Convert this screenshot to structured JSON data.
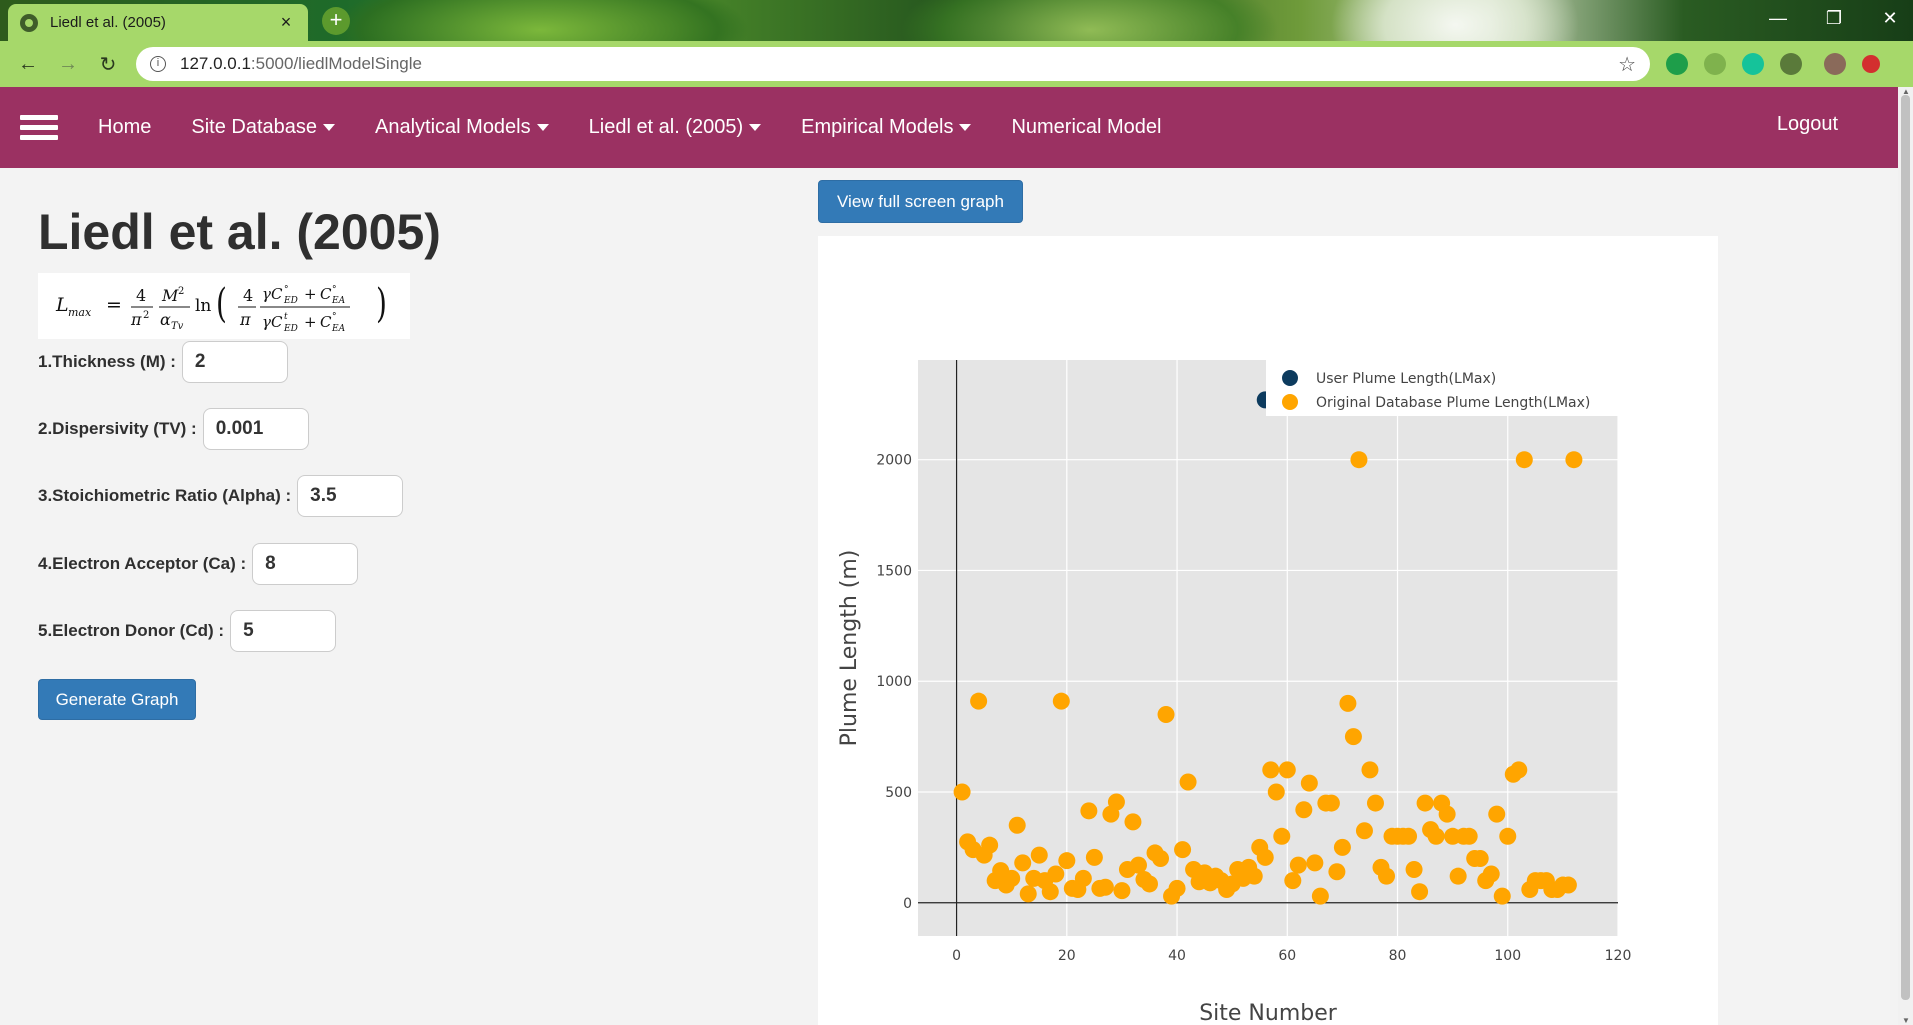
{
  "browser": {
    "tab_title": "Liedl et al. (2005)",
    "tab_close": "×",
    "new_tab": "+",
    "url_host": "127.0.0.1",
    "url_rest": ":5000/liedlModelSingle",
    "win_min": "—",
    "win_max": "❐",
    "win_close": "✕"
  },
  "nav": {
    "home": "Home",
    "site_database": "Site Database",
    "analytical_models": "Analytical Models",
    "liedl": "Liedl et al. (2005)",
    "empirical_models": "Empirical Models",
    "numerical_model": "Numerical Model",
    "logout": "Logout"
  },
  "page": {
    "title": "Liedl et al. (2005)"
  },
  "form": {
    "thickness_label": "1.Thickness (M) :",
    "thickness_value": "2",
    "dispersivity_label": "2.Dispersivity (TV) :",
    "dispersivity_value": "0.001",
    "stoich_label": "3.Stoichiometric Ratio (Alpha) :",
    "stoich_value": "3.5",
    "acceptor_label": "4.Electron Acceptor (Ca) :",
    "acceptor_value": "8",
    "donor_label": "5.Electron Donor (Cd) :",
    "donor_value": "5",
    "generate_label": "Generate Graph"
  },
  "graph_button": "View full screen graph",
  "colors": {
    "nav": "#9b3162",
    "user_series": "#0d3b5e",
    "db_series": "#ffa500",
    "button": "#337ab7"
  },
  "chart_data": {
    "type": "scatter",
    "xlabel": "Site Number",
    "ylabel": "Plume Length (m)",
    "xlim": [
      -7,
      120
    ],
    "ylim": [
      -150,
      2450
    ],
    "x_ticks": [
      0,
      20,
      40,
      60,
      80,
      100,
      120
    ],
    "y_ticks": [
      0,
      500,
      1000,
      1500,
      2000
    ],
    "grid": true,
    "legend_position": "top-right",
    "series": [
      {
        "name": "User Plume Length(LMax)",
        "color": "#0d3b5e",
        "points": [
          [
            56,
            2270
          ]
        ]
      },
      {
        "name": "Original Database Plume Length(LMax)",
        "color": "#ffa500",
        "points": [
          [
            1,
            500
          ],
          [
            2,
            275
          ],
          [
            3,
            240
          ],
          [
            4,
            910
          ],
          [
            5,
            215
          ],
          [
            6,
            260
          ],
          [
            7,
            100
          ],
          [
            8,
            145
          ],
          [
            9,
            80
          ],
          [
            10,
            110
          ],
          [
            11,
            350
          ],
          [
            12,
            180
          ],
          [
            13,
            40
          ],
          [
            14,
            110
          ],
          [
            15,
            215
          ],
          [
            16,
            100
          ],
          [
            17,
            50
          ],
          [
            18,
            130
          ],
          [
            19,
            910
          ],
          [
            20,
            190
          ],
          [
            21,
            65
          ],
          [
            22,
            60
          ],
          [
            23,
            110
          ],
          [
            24,
            415
          ],
          [
            25,
            205
          ],
          [
            26,
            65
          ],
          [
            27,
            70
          ],
          [
            28,
            400
          ],
          [
            29,
            455
          ],
          [
            30,
            55
          ],
          [
            31,
            150
          ],
          [
            32,
            365
          ],
          [
            33,
            170
          ],
          [
            34,
            105
          ],
          [
            35,
            85
          ],
          [
            36,
            225
          ],
          [
            37,
            200
          ],
          [
            38,
            850
          ],
          [
            39,
            30
          ],
          [
            40,
            65
          ],
          [
            41,
            240
          ],
          [
            42,
            545
          ],
          [
            43,
            150
          ],
          [
            44,
            95
          ],
          [
            45,
            135
          ],
          [
            46,
            90
          ],
          [
            47,
            120
          ],
          [
            48,
            100
          ],
          [
            49,
            60
          ],
          [
            50,
            85
          ],
          [
            51,
            150
          ],
          [
            52,
            110
          ],
          [
            53,
            160
          ],
          [
            54,
            120
          ],
          [
            55,
            250
          ],
          [
            56,
            205
          ],
          [
            57,
            600
          ],
          [
            58,
            500
          ],
          [
            59,
            300
          ],
          [
            60,
            600
          ],
          [
            61,
            100
          ],
          [
            62,
            170
          ],
          [
            63,
            420
          ],
          [
            64,
            540
          ],
          [
            65,
            180
          ],
          [
            66,
            30
          ],
          [
            67,
            450
          ],
          [
            68,
            450
          ],
          [
            69,
            140
          ],
          [
            70,
            250
          ],
          [
            71,
            900
          ],
          [
            72,
            750
          ],
          [
            73,
            2000
          ],
          [
            74,
            325
          ],
          [
            75,
            600
          ],
          [
            76,
            450
          ],
          [
            77,
            160
          ],
          [
            78,
            120
          ],
          [
            79,
            300
          ],
          [
            80,
            300
          ],
          [
            81,
            300
          ],
          [
            82,
            300
          ],
          [
            83,
            150
          ],
          [
            84,
            50
          ],
          [
            85,
            450
          ],
          [
            86,
            330
          ],
          [
            87,
            300
          ],
          [
            88,
            450
          ],
          [
            89,
            400
          ],
          [
            90,
            300
          ],
          [
            91,
            120
          ],
          [
            92,
            300
          ],
          [
            93,
            300
          ],
          [
            94,
            200
          ],
          [
            95,
            200
          ],
          [
            96,
            100
          ],
          [
            97,
            130
          ],
          [
            98,
            400
          ],
          [
            99,
            30
          ],
          [
            100,
            300
          ],
          [
            101,
            580
          ],
          [
            102,
            600
          ],
          [
            103,
            2000
          ],
          [
            104,
            60
          ],
          [
            105,
            100
          ],
          [
            106,
            100
          ],
          [
            107,
            100
          ],
          [
            108,
            60
          ],
          [
            109,
            60
          ],
          [
            110,
            80
          ],
          [
            111,
            80
          ],
          [
            112,
            2000
          ]
        ]
      }
    ]
  }
}
